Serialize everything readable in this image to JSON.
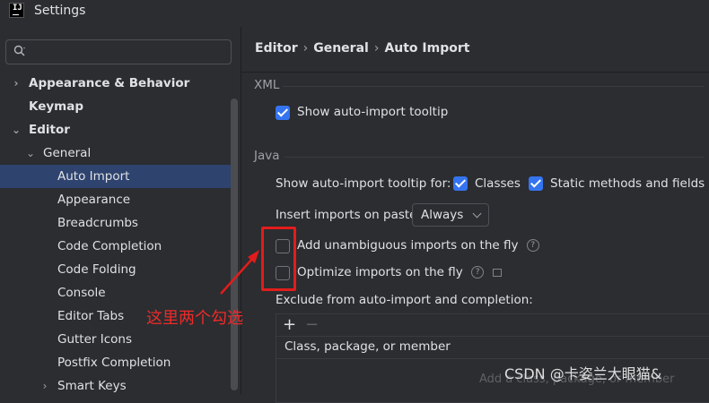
{
  "window": {
    "title": "Settings"
  },
  "sidebar": {
    "items": [
      {
        "label": "Appearance & Behavior"
      },
      {
        "label": "Keymap"
      },
      {
        "label": "Editor"
      },
      {
        "label": "General"
      },
      {
        "label": "Auto Import"
      },
      {
        "label": "Appearance"
      },
      {
        "label": "Breadcrumbs"
      },
      {
        "label": "Code Completion"
      },
      {
        "label": "Code Folding"
      },
      {
        "label": "Console"
      },
      {
        "label": "Editor Tabs"
      },
      {
        "label": "Gutter Icons"
      },
      {
        "label": "Postfix Completion"
      },
      {
        "label": "Smart Keys"
      }
    ]
  },
  "breadcrumb": {
    "parts": [
      "Editor",
      "General",
      "Auto Import"
    ]
  },
  "xml": {
    "heading": "XML",
    "show_tooltip_label": "Show auto-import tooltip",
    "show_tooltip_checked": true
  },
  "java": {
    "heading": "Java",
    "tooltip_for_label": "Show auto-import tooltip for:",
    "classes_label": "Classes",
    "classes_checked": true,
    "static_label": "Static methods and fields",
    "static_checked": true,
    "insert_on_paste_label": "Insert imports on paste:",
    "insert_on_paste_value": "Always",
    "add_unambiguous_label": "Add unambiguous imports on the fly",
    "add_unambiguous_checked": false,
    "optimize_label": "Optimize imports on the fly",
    "optimize_checked": false,
    "exclude_label": "Exclude from auto-import and completion:",
    "table": {
      "add_btn": "+",
      "remove_btn": "−",
      "column_header": "Class, package, or member",
      "empty_text": "Add a class, package, or member"
    }
  },
  "annotation": {
    "text": "这里两个勾选",
    "color": "#e21c1c"
  },
  "watermark": "CSDN @卡姿兰大眼猫&",
  "colors": {
    "accent": "#3574f0",
    "selection": "#2e436e",
    "background": "#2b2d30"
  },
  "icons": {
    "search": "search-icon",
    "help": "help-icon",
    "expand": "chevron-right-icon",
    "collapse": "chevron-down-icon"
  }
}
